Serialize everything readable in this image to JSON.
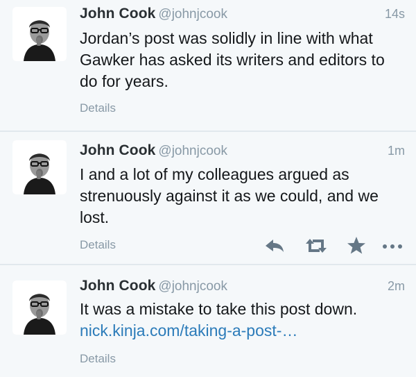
{
  "tweets": [
    {
      "name": "John Cook",
      "handle": "@johnjcook",
      "time": "14s",
      "text": "Jordan’s post was solidly in line with what Gawker has asked its writers and editors to do for years.",
      "details_label": "Details"
    },
    {
      "name": "John Cook",
      "handle": "@johnjcook",
      "time": "1m",
      "text": "I and a lot of my colleagues argued as strenuously against it as we could, and we lost.",
      "details_label": "Details",
      "actions": {
        "reply_icon": "reply-icon",
        "retweet_icon": "retweet-icon",
        "favorite_icon": "star-icon",
        "more_icon": "more-icon"
      }
    },
    {
      "name": "John Cook",
      "handle": "@johnjcook",
      "time": "2m",
      "text": "It was a mistake to take this post down.",
      "link": "nick.kinja.com/taking-a-post-…",
      "details_label": "Details"
    }
  ],
  "colors": {
    "background": "#f5f8fa",
    "name": "#292f33",
    "secondary": "#8899a6",
    "link": "#2b7bb9",
    "divider": "#e1e8ed"
  }
}
